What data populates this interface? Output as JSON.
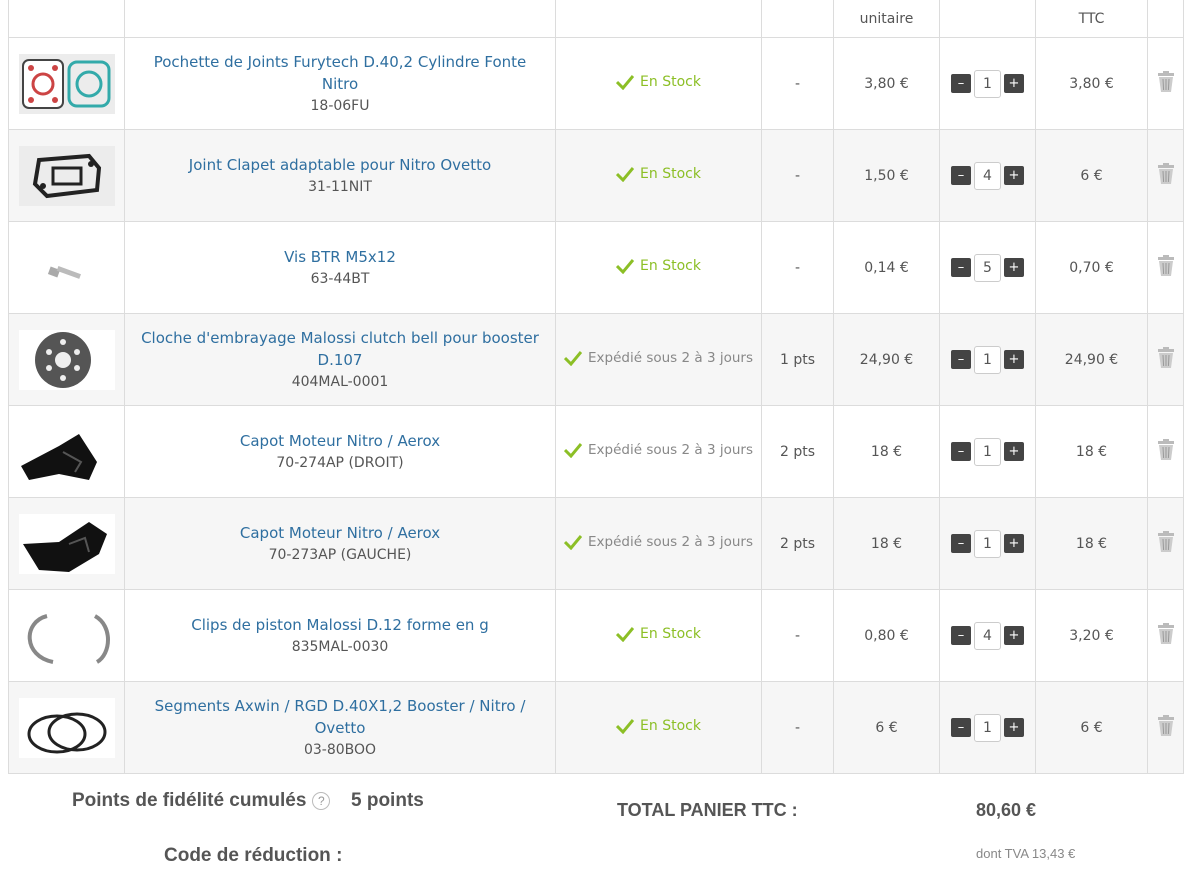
{
  "header": {
    "unit_price": "unitaire",
    "total_ttc": "TTC"
  },
  "rows": [
    {
      "name": "Pochette de Joints Furytech D.40,2 Cylindre Fonte Nitro",
      "ref": "18-06FU",
      "stock": "En Stock",
      "pts": "-",
      "price": "3,80 €",
      "qty": "1",
      "total": "3,80 €"
    },
    {
      "name": "Joint Clapet adaptable pour Nitro Ovetto",
      "ref": "31-11NIT",
      "stock": "En Stock",
      "pts": "-",
      "price": "1,50 €",
      "qty": "4",
      "total": "6 €"
    },
    {
      "name": "Vis BTR M5x12",
      "ref": "63-44BT",
      "stock": "En Stock",
      "pts": "-",
      "price": "0,14 €",
      "qty": "5",
      "total": "0,70 €"
    },
    {
      "name": "Cloche d'embrayage Malossi clutch bell pour booster D.107",
      "ref": "404MAL-0001",
      "stock": "Expédié sous 2 à 3 jours",
      "pts": "1 pts",
      "price": "24,90 €",
      "qty": "1",
      "total": "24,90 €"
    },
    {
      "name": "Capot Moteur Nitro / Aerox",
      "ref": "70-274AP (DROIT)",
      "stock": "Expédié sous 2 à 3 jours",
      "pts": "2 pts",
      "price": "18 €",
      "qty": "1",
      "total": "18 €"
    },
    {
      "name": "Capot Moteur Nitro / Aerox",
      "ref": "70-273AP (GAUCHE)",
      "stock": "Expédié sous 2 à 3 jours",
      "pts": "2 pts",
      "price": "18 €",
      "qty": "1",
      "total": "18 €"
    },
    {
      "name": "Clips de piston Malossi D.12 forme en g",
      "ref": "835MAL-0030",
      "stock": "En Stock",
      "pts": "-",
      "price": "0,80 €",
      "qty": "4",
      "total": "3,20 €"
    },
    {
      "name": "Segments Axwin / RGD D.40X1,2 Booster / Nitro / Ovetto",
      "ref": "03-80BOO",
      "stock": "En Stock",
      "pts": "-",
      "price": "6 €",
      "qty": "1",
      "total": "6 €"
    }
  ],
  "controls": {
    "minus": "–",
    "plus": "+"
  },
  "summary": {
    "loyalty_label": "Points de fidélité cumulés",
    "help": "?",
    "loyalty_value": "5 points",
    "total_label": "TOTAL PANIER TTC :",
    "total_value": "80,60 €",
    "promo_label": "Code de réduction :",
    "tva_note": "dont TVA 13,43 €"
  },
  "colors": {
    "instock": "#8cbf26",
    "link": "#2f6fa0",
    "button": "#444444"
  },
  "icons": {
    "stock": "check-icon",
    "delete": "trash-icon",
    "help": "question-circle-icon"
  }
}
